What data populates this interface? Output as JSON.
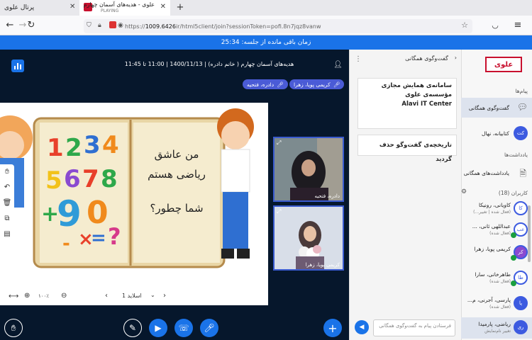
{
  "browser": {
    "tab1_title": "پرتال علوی",
    "tab2_title": "علوی - هدیه‌های آسمان چهارم",
    "tab2_sub": "PLAYING",
    "url_scheme": "https://",
    "url_host": "1009.6426",
    "url_path": "ir/html5client/join?sessionToken=pofi.8n7jqz8vanw"
  },
  "timer": {
    "text": "زمان باقی مانده از جلسه: 25:34"
  },
  "session": {
    "title": "هدیه‌های آسمان چهارم ( خانم دادره) | 1400/11/13 | 11:00 تا 11:45",
    "tags": [
      "کریمی پویا، زهرا",
      "دادره، فتحیه"
    ]
  },
  "slide": {
    "line1": "من عاشق",
    "line2": "ریاضی هستم",
    "line3": "شما چطور؟",
    "numbers": [
      "1",
      "2",
      "3",
      "4",
      "5",
      "6",
      "7",
      "8",
      "9",
      "0",
      "+",
      "×",
      "=",
      "?",
      "-",
      "÷"
    ],
    "page_label": "اسلاید 1",
    "zoom": "۱۰۰٪"
  },
  "videos": [
    {
      "name": "دادره، فتحیه"
    },
    {
      "name": "کریمی پویا، زهرا"
    }
  ],
  "chat": {
    "header": "گفت‌وگوی همگانی",
    "welcome_line1": "سامانه‌ی همایش مجازی",
    "welcome_line2": "مؤسسه‌ی علوی",
    "welcome_line3": "Alavi IT Center",
    "cleared": "تاریخچه‌ی گفت‌وگو حذف گردید",
    "input_placeholder": "فرستادن پیام به گفت‌وگوی همگانی"
  },
  "sidebar": {
    "logo": "علوی",
    "messages_title": "پیام‌ها",
    "public_chat": "گفت‌وگوی همگانی",
    "current_user": "کتابیانه، نهال",
    "current_user_initials": "کت",
    "notes_title": "یادداشت‌ها",
    "shared_notes": "یادداشت‌های همگانی",
    "users_title": "کاربران (18)",
    "users": [
      {
        "name": "کاویانی، رونیکا",
        "status": "(فعال شده | تغییر...)",
        "initials": "کا"
      },
      {
        "name": "عبداللهی ثانی، ...",
        "status": "(فعال شده)",
        "initials": "عب"
      },
      {
        "name": "کریمی پویا، زهرا",
        "status": "",
        "initials": "کر"
      },
      {
        "name": "طاهرخانی، سارا",
        "status": "(فعال شده)",
        "initials": "طا"
      },
      {
        "name": "پارسی، آجرنی، م...",
        "status": "(فعال شده)",
        "initials": "پا"
      },
      {
        "name": "ریاضی، پارمیدا",
        "status": "تغییر نام‌نمایش",
        "initials": "ری"
      }
    ]
  },
  "colors": {
    "accent": "#1a73e8",
    "stage": "#06172c",
    "tag": "#4a5bd6",
    "logo": "#c8102e"
  }
}
